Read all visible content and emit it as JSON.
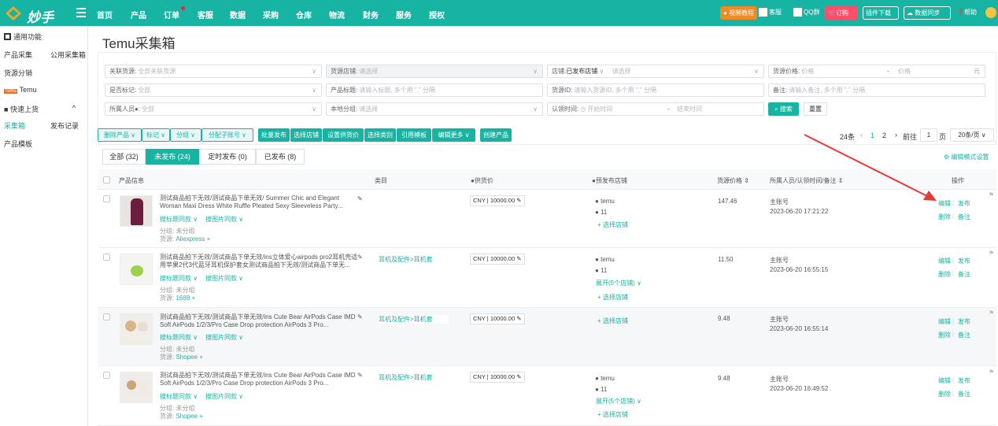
{
  "app": {
    "logo_text": "妙手"
  },
  "nav": {
    "items": [
      "首页",
      "产品",
      "订单",
      "客服",
      "数据",
      "采购",
      "仓库",
      "物流",
      "财务",
      "服务",
      "授权"
    ],
    "tools": [
      "视频教程",
      "客服",
      "QQ群",
      "订购",
      "插件下载",
      "数据同步",
      "帮助"
    ]
  },
  "sidebar": {
    "general": "通用功能",
    "product_collect": "产品采集",
    "public_box": "公用采集箱",
    "source": "货源分销",
    "temu_badge": "Temu",
    "temu": "Temu",
    "quick_upload": "快速上货",
    "collect_box": "采集箱",
    "publish_log": "发布记录",
    "template": "产品模板"
  },
  "page": {
    "title": "Temu采集箱"
  },
  "filters": {
    "related_source": {
      "label": "关联货源:",
      "placeholder": "全部关联货源"
    },
    "source_store": {
      "label": "货源店铺:",
      "placeholder": "请选择"
    },
    "store": {
      "label": "店铺:",
      "value": "已发布店铺",
      "placeholder": "请选择"
    },
    "source_price": {
      "label": "货源价格:",
      "min": "价格",
      "dash": "-",
      "max": "价格",
      "unit": "元"
    },
    "marked": {
      "label": "是否标记:",
      "placeholder": "全部"
    },
    "product_title": {
      "label": "产品标题:",
      "placeholder": "请输入标题, 多个用 \",\" 分隔"
    },
    "source_id": {
      "label": "货源ID:",
      "placeholder": "请输入货源ID, 多个用 \",\" 分隔"
    },
    "remark": {
      "label": "备注:",
      "placeholder": "请输入备注, 多个用 \",\" 分隔"
    },
    "owner": {
      "label": "所属人员",
      "placeholder": "全部"
    },
    "local_group": {
      "label": "本地分组:",
      "placeholder": "请选择"
    },
    "claim_time": {
      "label": "认领时间:",
      "start": "开始时间",
      "dash": "-",
      "end": "结束时间"
    },
    "search": "搜索",
    "reset": "重置"
  },
  "actions": {
    "delete_product": "删除产品",
    "mark": "标记",
    "group": "分组",
    "assign_account": "分配子账号",
    "batch_publish": "批量发布",
    "select_store": "选择店铺",
    "set_supply_price": "设置供货价",
    "select_category": "选择类别",
    "use_template": "引用模板",
    "edit_more": "编辑更多",
    "create_product": "创建产品"
  },
  "tabs": {
    "all": "全部 (32)",
    "unpublished": "未发布 (24)",
    "scheduled": "定时发布 (0)",
    "published": "已发布 (8)"
  },
  "pagination": {
    "total": "24条",
    "pages": [
      "1",
      "2"
    ],
    "goto": "前往",
    "current": "1",
    "page_unit": "页",
    "per_page": "20条/页",
    "edit_mode": "编辑模式设置"
  },
  "table": {
    "headers": [
      "产品信息",
      "类目",
      "供货价",
      "预发布店铺",
      "货源价格",
      "所属人员/认领时间/备注",
      "操作"
    ],
    "rows": [
      {
        "title": "测试商品拍下无效/测试商品下单无效/ Summer Chic and Elegant Woman Maxi Dress White Ruffle Pleated Sexy Sleeveless Party...",
        "category": "",
        "currency": "CNY",
        "supply_price": "10000.00",
        "stores": [
          "temu",
          "11"
        ],
        "expand": "",
        "select_store": "+ 选择店铺",
        "source_price": "147.46",
        "owner": "主账号",
        "time": "2023-06-20 17:21:22",
        "search_title": "搜标题同款",
        "search_image": "搜图片同款",
        "group": "分组: 未分组",
        "source_label": "货源:",
        "source": "Aliexpress",
        "ops": [
          "编辑",
          "发布",
          "删除",
          "备注"
        ]
      },
      {
        "title": "测试商品拍下无效/测试商品下单无效/ins立体爱心airpods pro2耳机壳适用苹果2代3代蓝牙耳机保护套女测试商品拍下无效/测试商品下单无...",
        "category": "耳机及配件>耳机套",
        "currency": "CNY",
        "supply_price": "10000.00",
        "stores": [
          "temu",
          "11"
        ],
        "expand": "展开(5个店铺)",
        "select_store": "+ 选择店铺",
        "source_price": "11.50",
        "owner": "主账号",
        "time": "2023-06-20 16:55:15",
        "search_title": "搜标题同款",
        "search_image": "搜图片同款",
        "group": "分组: 未分组",
        "source_label": "货源:",
        "source": "1688",
        "ops": [
          "编辑",
          "发布",
          "删除",
          "备注"
        ]
      },
      {
        "title": "测试商品拍下无效/测试商品下单无效/ins Cute Bear AirPods Case IMD Soft AirPods 1/2/3/Pro Case Drop protection AirPods 3 Pro...",
        "category": "耳机及配件>耳机套",
        "currency": "CNY",
        "supply_price": "10000.00",
        "stores": [],
        "expand": "",
        "select_store": "+ 选择店铺",
        "source_price": "9.48",
        "owner": "主账号",
        "time": "2023-06-20 16:55:14",
        "search_title": "搜标题同款",
        "search_image": "搜图片同款",
        "group": "分组: 未分组",
        "source_label": "货源:",
        "source": "Shopee",
        "ops": [
          "编辑",
          "发布",
          "删除",
          "备注"
        ]
      },
      {
        "title": "测试商品拍下无效/测试商品下单无效/ins Cute Bear AirPods Case IMD Soft AirPods 1/2/3/Pro Case Drop protection AirPods 3 Pro...",
        "category": "耳机及配件>耳机套",
        "currency": "CNY",
        "supply_price": "10000.00",
        "stores": [
          "temu",
          "11"
        ],
        "expand": "展开(5个店铺)",
        "select_store": "+ 选择店铺",
        "source_price": "9.48",
        "owner": "主账号",
        "time": "2023-06-20 16:49:52",
        "search_title": "搜标题同款",
        "search_image": "搜图片同款",
        "group": "分组: 未分组",
        "source_label": "货源:",
        "source": "Shopee",
        "ops": [
          "编辑",
          "发布",
          "删除",
          "备注"
        ]
      }
    ]
  },
  "colors": {
    "brand": "#17b3a3",
    "annotation_arrow": "#e53935"
  }
}
